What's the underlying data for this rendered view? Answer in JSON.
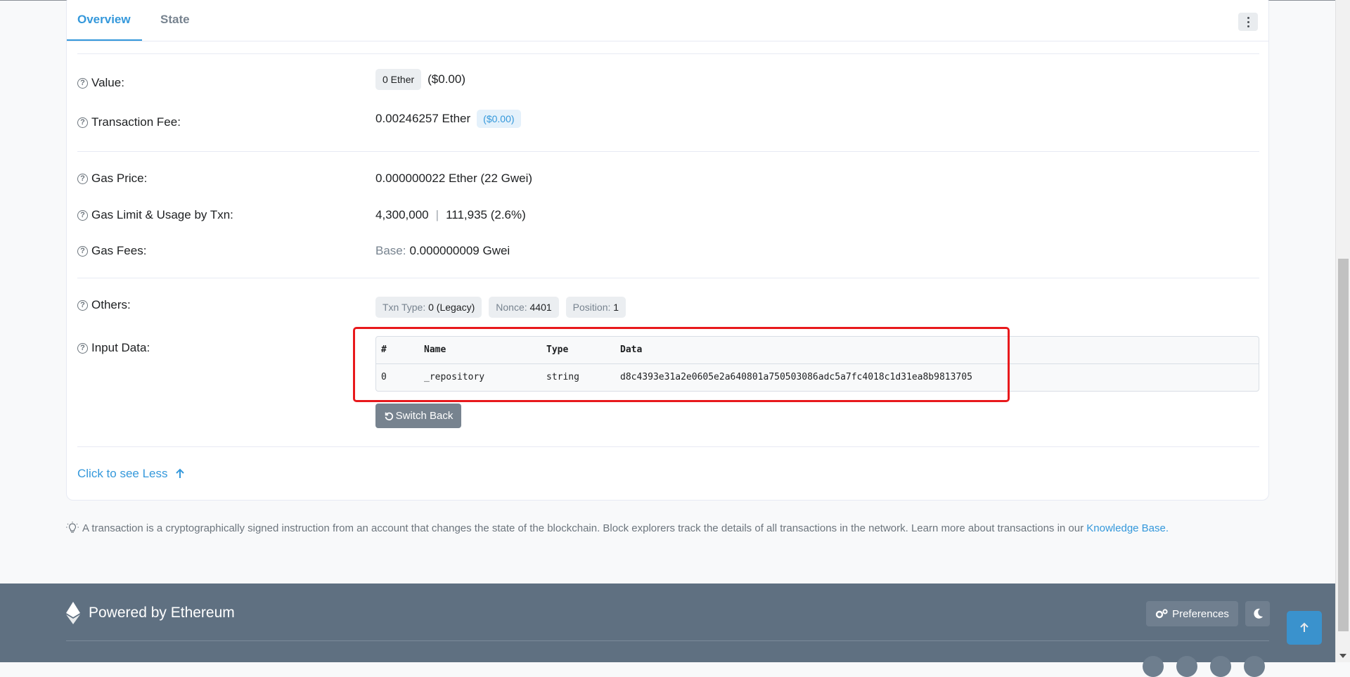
{
  "tabs": [
    {
      "label": "Overview",
      "active": true
    },
    {
      "label": "State",
      "active": false
    }
  ],
  "rows": {
    "value": {
      "label": "Value:",
      "badge": "0 Ether",
      "usd": "($0.00)"
    },
    "fee": {
      "label": "Transaction Fee:",
      "amount": "0.00246257 Ether",
      "usd": "($0.00)"
    },
    "gas_price": {
      "label": "Gas Price:",
      "value": "0.000000022 Ether (22 Gwei)"
    },
    "gas_limit": {
      "label": "Gas Limit & Usage by Txn:",
      "limit": "4,300,000",
      "separator": "|",
      "usage": "111,935 (2.6%)"
    },
    "gas_fees": {
      "label": "Gas Fees:",
      "base_label": "Base:",
      "base_value": "0.000000009 Gwei"
    },
    "others": {
      "label": "Others:",
      "badges": [
        {
          "key": "Txn Type:",
          "value": "0 (Legacy)"
        },
        {
          "key": "Nonce:",
          "value": "4401"
        },
        {
          "key": "Position:",
          "value": "1"
        }
      ]
    },
    "input_data": {
      "label": "Input Data:",
      "columns": [
        "#",
        "Name",
        "Type",
        "Data"
      ],
      "rows": [
        [
          "0",
          "_repository",
          "string",
          "d8c4393e31a2e0605e2a640801a750503086adc5a7fc4018c1d31ea8b9813705"
        ]
      ],
      "switch_label": "Switch Back"
    }
  },
  "see_less": "Click to see Less",
  "footnote": {
    "text": "A transaction is a cryptographically signed instruction from an account that changes the state of the blockchain. Block explorers track the details of all transactions in the network. Learn more about transactions in our",
    "link": "Knowledge Base."
  },
  "footer": {
    "brand": "Powered by Ethereum",
    "preferences": "Preferences"
  },
  "colors": {
    "accent": "#3498db",
    "highlight": "#e8191c",
    "footer_bg": "#5f7081"
  }
}
